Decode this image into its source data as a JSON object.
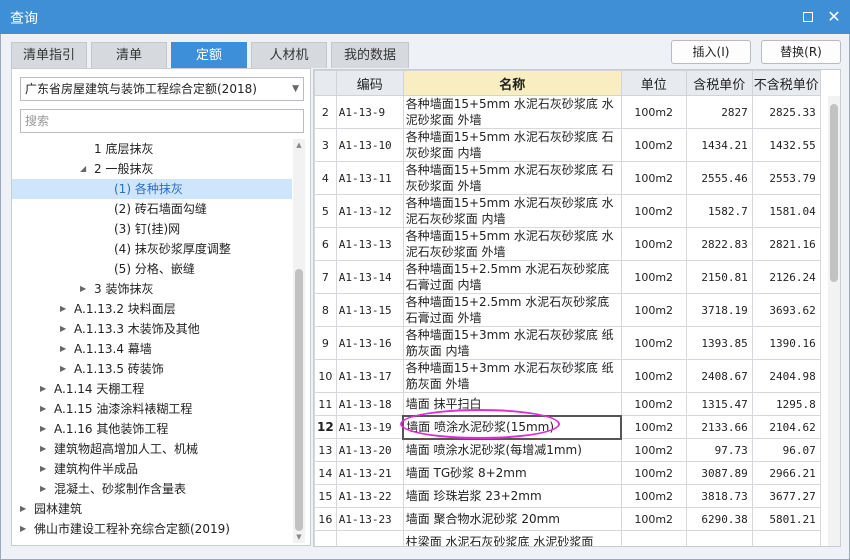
{
  "window": {
    "title": "查询"
  },
  "tabs": [
    {
      "label": "清单指引"
    },
    {
      "label": "清单"
    },
    {
      "label": "定额"
    },
    {
      "label": "人材机"
    },
    {
      "label": "我的数据"
    }
  ],
  "actions": {
    "insert_label": "插入(I)",
    "replace_label": "替换(R)"
  },
  "left": {
    "dropdown_value": "广东省房屋建筑与装饰工程综合定额(2018)",
    "search_placeholder": "搜索",
    "tree": [
      {
        "label": "1 底层抹灰",
        "arrow": ""
      },
      {
        "label": "2 一般抹灰",
        "arrow": "expanded"
      },
      {
        "label": "(1) 各种抹灰",
        "arrow": "",
        "selected": true
      },
      {
        "label": "(2) 砖石墙面勾缝",
        "arrow": ""
      },
      {
        "label": "(3) 钉(挂)网",
        "arrow": ""
      },
      {
        "label": "(4) 抹灰砂浆厚度调整",
        "arrow": ""
      },
      {
        "label": "(5) 分格、嵌缝",
        "arrow": ""
      },
      {
        "label": "3 装饰抹灰",
        "arrow": "collapsed"
      },
      {
        "label": "A.1.13.2 块料面层",
        "arrow": "collapsed"
      },
      {
        "label": "A.1.13.3 木装饰及其他",
        "arrow": "collapsed"
      },
      {
        "label": "A.1.13.4 幕墙",
        "arrow": "collapsed"
      },
      {
        "label": "A.1.13.5 砖装饰",
        "arrow": "collapsed"
      },
      {
        "label": "A.1.14 天棚工程",
        "arrow": "collapsed"
      },
      {
        "label": "A.1.15 油漆涂料裱糊工程",
        "arrow": "collapsed"
      },
      {
        "label": "A.1.16 其他装饰工程",
        "arrow": "collapsed"
      },
      {
        "label": "建筑物超高增加人工、机械",
        "arrow": "collapsed"
      },
      {
        "label": "建筑构件半成品",
        "arrow": "collapsed"
      },
      {
        "label": "混凝土、砂浆制作含量表",
        "arrow": "collapsed"
      },
      {
        "label": "园林建筑",
        "arrow": "collapsed"
      },
      {
        "label": "佛山市建设工程补充综合定额(2019)",
        "arrow": "collapsed"
      }
    ]
  },
  "grid": {
    "headers": {
      "code": "编码",
      "name": "名称",
      "unit": "单位",
      "tax_price": "含税单价",
      "notax_price": "不含税单价"
    },
    "rows": [
      {
        "n": "2",
        "code": "A1-13-9",
        "name": "各种墙面15+5mm 水泥石灰砂浆底 水泥砂浆面 外墙",
        "unit": "100m2",
        "tax": "2827",
        "notax": "2825.33"
      },
      {
        "n": "3",
        "code": "A1-13-10",
        "name": "各种墙面15+5mm 水泥石灰砂浆底 石灰砂浆面 内墙",
        "unit": "100m2",
        "tax": "1434.21",
        "notax": "1432.55"
      },
      {
        "n": "4",
        "code": "A1-13-11",
        "name": "各种墙面15+5mm 水泥石灰砂浆底 石灰砂浆面 外墙",
        "unit": "100m2",
        "tax": "2555.46",
        "notax": "2553.79"
      },
      {
        "n": "5",
        "code": "A1-13-12",
        "name": "各种墙面15+5mm 水泥石灰砂浆底 水泥石灰砂浆面 内墙",
        "unit": "100m2",
        "tax": "1582.7",
        "notax": "1581.04"
      },
      {
        "n": "6",
        "code": "A1-13-13",
        "name": "各种墙面15+5mm 水泥石灰砂浆底 水泥石灰砂浆面 外墙",
        "unit": "100m2",
        "tax": "2822.83",
        "notax": "2821.16"
      },
      {
        "n": "7",
        "code": "A1-13-14",
        "name": "各种墙面15+2.5mm 水泥石灰砂浆底 石膏过面 内墙",
        "unit": "100m2",
        "tax": "2150.81",
        "notax": "2126.24"
      },
      {
        "n": "8",
        "code": "A1-13-15",
        "name": "各种墙面15+2.5mm 水泥石灰砂浆底 石膏过面 外墙",
        "unit": "100m2",
        "tax": "3718.19",
        "notax": "3693.62"
      },
      {
        "n": "9",
        "code": "A1-13-16",
        "name": "各种墙面15+3mm 水泥石灰砂浆底 纸筋灰面 内墙",
        "unit": "100m2",
        "tax": "1393.85",
        "notax": "1390.16"
      },
      {
        "n": "10",
        "code": "A1-13-17",
        "name": "各种墙面15+3mm 水泥石灰砂浆底 纸筋灰面 外墙",
        "unit": "100m2",
        "tax": "2408.67",
        "notax": "2404.98"
      },
      {
        "n": "11",
        "code": "A1-13-18",
        "name": "墙面 抹平扫白",
        "unit": "100m2",
        "tax": "1315.47",
        "notax": "1295.8"
      },
      {
        "n": "12",
        "code": "A1-13-19",
        "name": "墙面 喷涂水泥砂浆(15mm)",
        "unit": "100m2",
        "tax": "2133.66",
        "notax": "2104.62"
      },
      {
        "n": "13",
        "code": "A1-13-20",
        "name": "墙面 喷涂水泥砂浆(每增减1mm)",
        "unit": "100m2",
        "tax": "97.73",
        "notax": "96.07"
      },
      {
        "n": "14",
        "code": "A1-13-21",
        "name": "墙面 TG砂浆 8+2mm",
        "unit": "100m2",
        "tax": "3087.89",
        "notax": "2966.21"
      },
      {
        "n": "15",
        "code": "A1-13-22",
        "name": "墙面 珍珠岩浆 23+2mm",
        "unit": "100m2",
        "tax": "3818.73",
        "notax": "3677.27"
      },
      {
        "n": "16",
        "code": "A1-13-23",
        "name": "墙面 聚合物水泥砂浆 20mm",
        "unit": "100m2",
        "tax": "6290.38",
        "notax": "5801.21"
      },
      {
        "n": "",
        "code": "",
        "name": "柱梁面 水泥石灰砂浆底 水泥砂浆面",
        "unit": "",
        "tax": "",
        "notax": ""
      }
    ]
  }
}
